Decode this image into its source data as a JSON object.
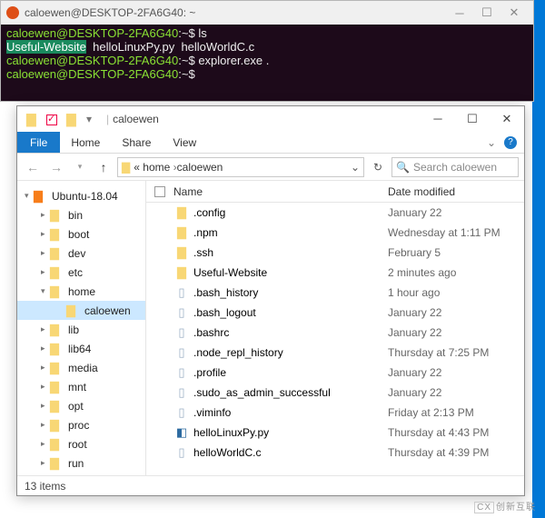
{
  "terminal": {
    "title": "caloewen@DESKTOP-2FA6G40: ~",
    "lines": {
      "l1_user": "caloewen@DESKTOP-2FA6G40",
      "l1_path": ":~$ ",
      "l1_cmd": "ls",
      "l2_sel": "Useful-Website",
      "l2_rest": "  helloLinuxPy.py  helloWorldC.c",
      "l3_user": "caloewen@DESKTOP-2FA6G40",
      "l3_path": ":~$ ",
      "l3_cmd": "explorer.exe .",
      "l4_user": "caloewen@DESKTOP-2FA6G40",
      "l4_path": ":~$ "
    }
  },
  "explorer": {
    "title_tab": "caloewen",
    "ribbon": {
      "file": "File",
      "home": "Home",
      "share": "Share",
      "view": "View"
    },
    "address": {
      "prefix": "«",
      "seg1": "home",
      "seg2": "caloewen"
    },
    "search_placeholder": "Search caloewen",
    "columns": {
      "name": "Name",
      "date": "Date modified"
    },
    "tree": {
      "root": "Ubuntu-18.04",
      "items": [
        "bin",
        "boot",
        "dev",
        "etc",
        "home",
        "lib",
        "lib64",
        "media",
        "mnt",
        "opt",
        "proc",
        "root",
        "run"
      ],
      "home_child": "caloewen"
    },
    "files": [
      {
        "name": ".config",
        "date": "January 22",
        "type": "folder"
      },
      {
        "name": ".npm",
        "date": "Wednesday at 1:11 PM",
        "type": "folder"
      },
      {
        "name": ".ssh",
        "date": "February 5",
        "type": "folder"
      },
      {
        "name": "Useful-Website",
        "date": "2 minutes ago",
        "type": "folder"
      },
      {
        "name": ".bash_history",
        "date": "1 hour ago",
        "type": "file"
      },
      {
        "name": ".bash_logout",
        "date": "January 22",
        "type": "file"
      },
      {
        "name": ".bashrc",
        "date": "January 22",
        "type": "file"
      },
      {
        "name": ".node_repl_history",
        "date": "Thursday at 7:25 PM",
        "type": "file"
      },
      {
        "name": ".profile",
        "date": "January 22",
        "type": "file"
      },
      {
        "name": ".sudo_as_admin_successful",
        "date": "January 22",
        "type": "file"
      },
      {
        "name": ".viminfo",
        "date": "Friday at 2:13 PM",
        "type": "file"
      },
      {
        "name": "helloLinuxPy.py",
        "date": "Thursday at 4:43 PM",
        "type": "py"
      },
      {
        "name": "helloWorldC.c",
        "date": "Thursday at 4:39 PM",
        "type": "file"
      }
    ],
    "status": "13 items"
  },
  "watermark": "创新互联"
}
